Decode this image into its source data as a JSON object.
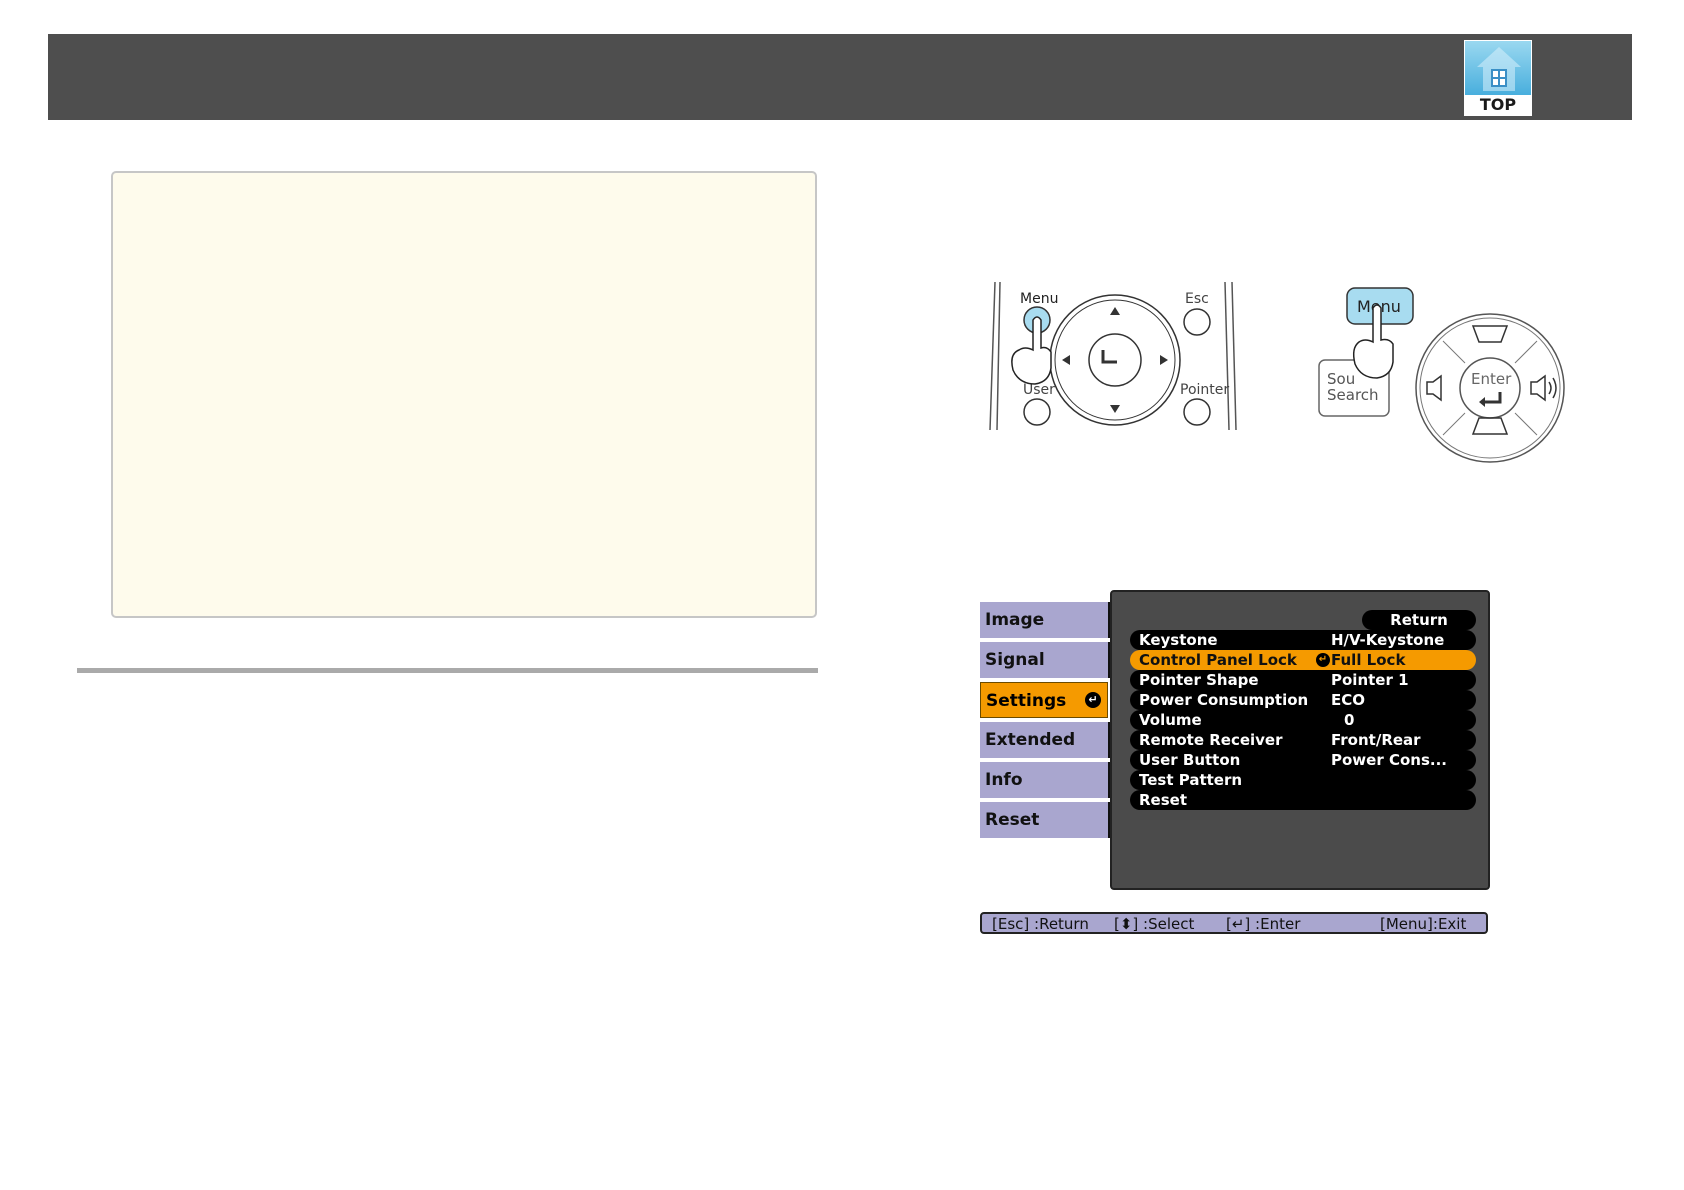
{
  "header": {
    "top_button_label": "TOP"
  },
  "remote_control": {
    "menu_label": "Menu",
    "esc_label": "Esc",
    "user_label": "User",
    "pointer_label": "Pointer"
  },
  "control_panel": {
    "menu_label": "Menu",
    "source_label_line1": "Sou",
    "source_label_line2": "Search",
    "enter_label": "Enter"
  },
  "osd_menu": {
    "sidebar": [
      {
        "label": "Image",
        "active": false
      },
      {
        "label": "Signal",
        "active": false
      },
      {
        "label": "Settings",
        "active": true
      },
      {
        "label": "Extended",
        "active": false
      },
      {
        "label": "Info",
        "active": false
      },
      {
        "label": "Reset",
        "active": false
      }
    ],
    "return_label": "Return",
    "rows": [
      {
        "label": "Keystone",
        "value": "H/V-Keystone"
      },
      {
        "label": "Control Panel Lock",
        "value": "Full Lock",
        "highlighted": true
      },
      {
        "label": "Pointer Shape",
        "value": "Pointer 1"
      },
      {
        "label": "Power Consumption",
        "value": "ECO"
      },
      {
        "label": "Volume",
        "value": "0"
      },
      {
        "label": "Remote Receiver",
        "value": "Front/Rear"
      },
      {
        "label": "User Button",
        "value": "Power Cons..."
      },
      {
        "label": "Test Pattern",
        "value": ""
      },
      {
        "label": "Reset",
        "value": ""
      }
    ],
    "help": {
      "esc": "[Esc] :Return",
      "select": "[⬍] :Select",
      "enter": "[↵] :Enter",
      "exit": "[Menu]:Exit"
    }
  }
}
